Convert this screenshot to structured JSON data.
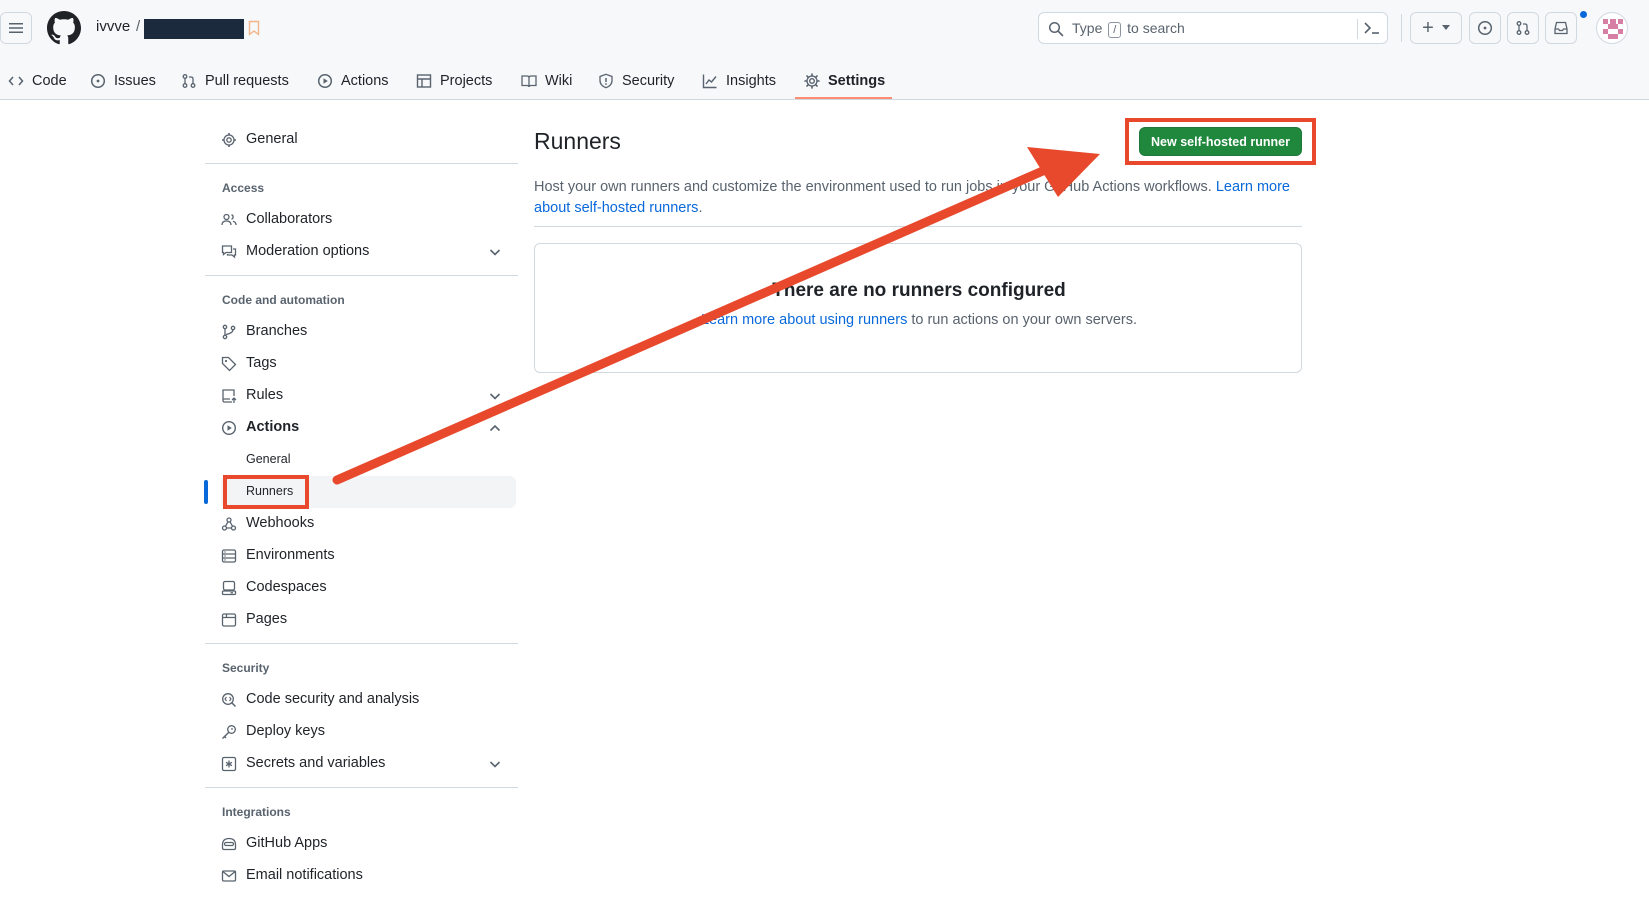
{
  "header": {
    "owner": "ivvve",
    "slash": "/",
    "search": {
      "prefix": "Type",
      "key": "/",
      "suffix": "to search"
    },
    "new_menu_plus": "+"
  },
  "repo_tabs": [
    {
      "label": "Code",
      "icon": "code-icon"
    },
    {
      "label": "Issues",
      "icon": "issue-icon"
    },
    {
      "label": "Pull requests",
      "icon": "pull-request-icon"
    },
    {
      "label": "Actions",
      "icon": "play-icon"
    },
    {
      "label": "Projects",
      "icon": "table-icon"
    },
    {
      "label": "Wiki",
      "icon": "book-icon"
    },
    {
      "label": "Security",
      "icon": "shield-icon"
    },
    {
      "label": "Insights",
      "icon": "graph-icon"
    },
    {
      "label": "Settings",
      "icon": "gear-icon",
      "selected": true
    }
  ],
  "sidebar": {
    "general": "General",
    "access_heading": "Access",
    "collaborators": "Collaborators",
    "moderation": "Moderation options",
    "code_heading": "Code and automation",
    "branches": "Branches",
    "tags": "Tags",
    "rules": "Rules",
    "actions": "Actions",
    "actions_general": "General",
    "actions_runners": "Runners",
    "webhooks": "Webhooks",
    "environments": "Environments",
    "codespaces": "Codespaces",
    "pages": "Pages",
    "security_heading": "Security",
    "code_security": "Code security and analysis",
    "deploy_keys": "Deploy keys",
    "secrets": "Secrets and variables",
    "integrations_heading": "Integrations",
    "github_apps": "GitHub Apps",
    "email_notifications": "Email notifications"
  },
  "main": {
    "title": "Runners",
    "new_runner_button": "New self-hosted runner",
    "description": "Host your own runners and customize the environment used to run jobs in your GitHub Actions workflows.",
    "description_link": "Learn more about self-hosted runners",
    "description_period": ".",
    "empty_title": "There are no runners configured",
    "empty_link": "Learn more about using runners",
    "empty_text": " to run actions on your own servers."
  },
  "colors": {
    "primary_button": "#1f883d",
    "annotation": "#e8492c",
    "link": "#0969da",
    "selected_tab_underline": "#fd8c73"
  }
}
